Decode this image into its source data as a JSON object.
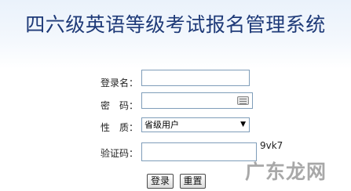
{
  "header": {
    "title": "四六级英语等级考试报名管理系统"
  },
  "form": {
    "username_label": "登录名：",
    "password_label": "密　码：",
    "role_label": "性　质：",
    "captcha_label": "验证码：",
    "role_selected": "省级用户",
    "captcha_code": "9vk7",
    "login_button": "登录",
    "reset_button": "重置"
  },
  "watermark": "广东龙网",
  "colors": {
    "title": "#1e3a78",
    "input_border": "#7f9db9",
    "header_gradient_top": "#eaf2fb"
  }
}
